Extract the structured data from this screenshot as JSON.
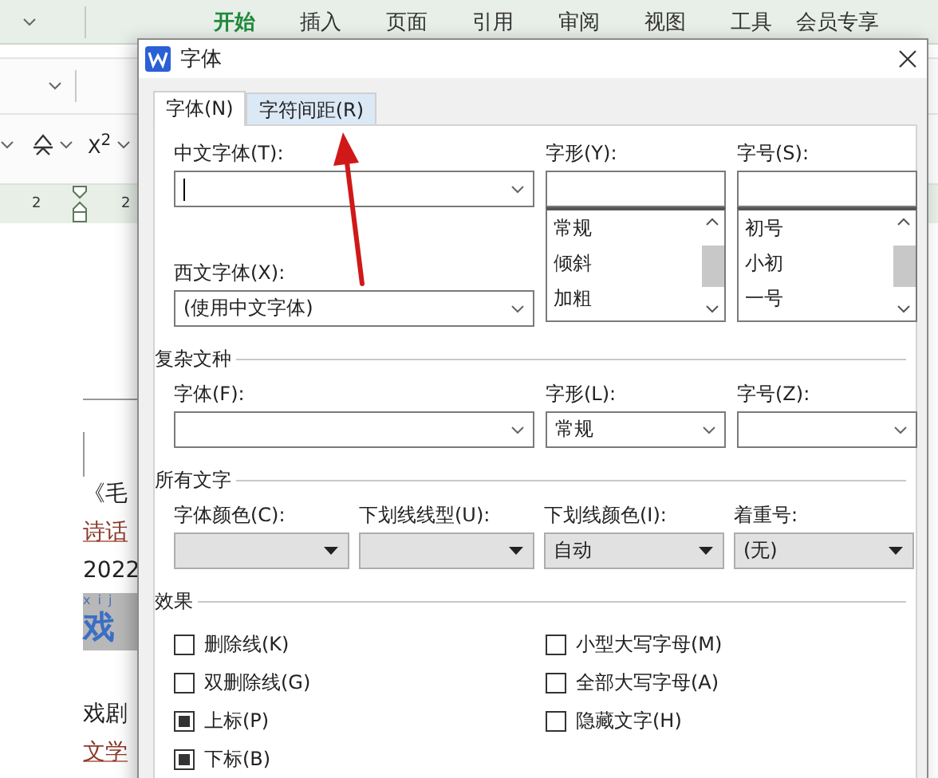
{
  "ribbon": {
    "tabs": [
      {
        "label": "开始",
        "selected": true
      },
      {
        "label": "插入",
        "selected": false
      },
      {
        "label": "页面",
        "selected": false
      },
      {
        "label": "引用",
        "selected": false
      },
      {
        "label": "审阅",
        "selected": false
      },
      {
        "label": "视图",
        "selected": false
      },
      {
        "label": "工具",
        "selected": false
      },
      {
        "label": "会员专享",
        "selected": false
      }
    ]
  },
  "toolbar": {
    "superscript": "X$^{2}$"
  },
  "ruler": {
    "marks": [
      "2",
      "2"
    ]
  },
  "document": {
    "lines": [
      {
        "kind": "plain",
        "text": "《毛"
      },
      {
        "kind": "link",
        "text": "诗话"
      },
      {
        "kind": "plain",
        "text": "2022"
      },
      {
        "kind": "heading",
        "text": "戏",
        "ruby": "x i j"
      },
      {
        "kind": "plain",
        "text": "戏剧"
      },
      {
        "kind": "link",
        "text": "文学"
      }
    ]
  },
  "dialog": {
    "title": "字体",
    "tabs": [
      {
        "label": "字体(N)",
        "selected": true
      },
      {
        "label": "字符间距(R)",
        "selected": false
      }
    ],
    "chinese_font": {
      "label": "中文字体(T):"
    },
    "western_font": {
      "label": "西文字体(X):",
      "value": "(使用中文字体)"
    },
    "font_style": {
      "label": "字形(Y):",
      "options": [
        "常规",
        "倾斜",
        "加粗"
      ]
    },
    "font_size": {
      "label": "字号(S):",
      "options": [
        "初号",
        "小初",
        "一号"
      ]
    },
    "complex": {
      "title": "复杂文种",
      "font": {
        "label": "字体(F):"
      },
      "style": {
        "label": "字形(L):",
        "value": "常规"
      },
      "size": {
        "label": "字号(Z):"
      }
    },
    "all_text": {
      "title": "所有文字",
      "dropdowns": [
        {
          "label": "字体颜色(C):"
        },
        {
          "label": "下划线线型(U):"
        },
        {
          "label": "下划线颜色(I):",
          "value": "自动"
        },
        {
          "label": "着重号:",
          "value": "(无)"
        }
      ]
    },
    "effects": {
      "title": "效果",
      "checkboxes": [
        {
          "label": "删除线(K)",
          "checked": false
        },
        {
          "label": "双删除线(G)",
          "checked": false
        },
        {
          "label": "上标(P)",
          "checked": true
        },
        {
          "label": "下标(B)",
          "checked": true
        },
        {
          "label": "小型大写字母(M)",
          "checked": false
        },
        {
          "label": "全部大写字母(A)",
          "checked": false
        },
        {
          "label": "隐藏文字(H)",
          "checked": false
        }
      ]
    }
  }
}
